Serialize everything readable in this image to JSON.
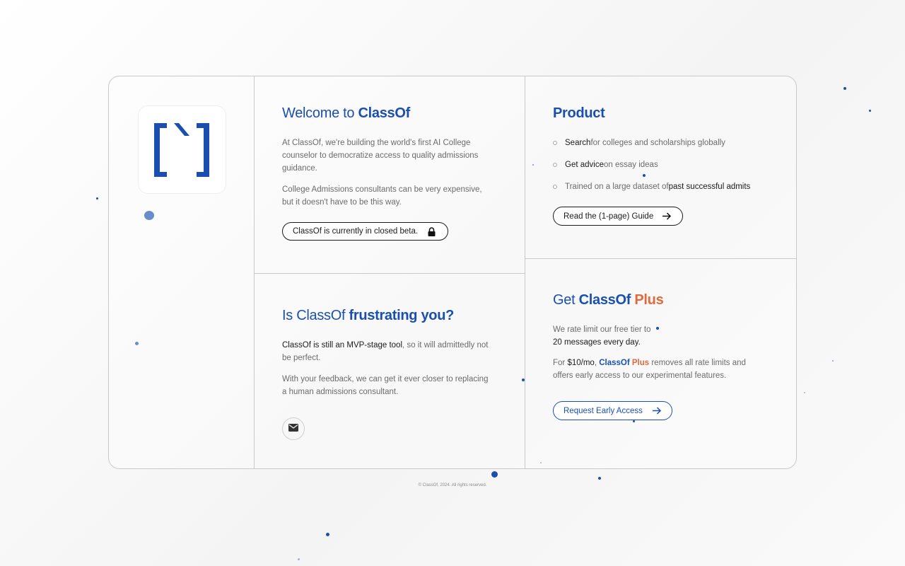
{
  "brand": {
    "name": "ClassOf",
    "accent": "#1a4fb0",
    "plus_color": "#e06a3b"
  },
  "welcome": {
    "title_prefix": "Welcome to ",
    "title_brand": "ClassOf",
    "para1": "At ClassOf, we're building the world's first AI College counselor to democratize access to quality admissions guidance.",
    "para2": "College Admissions consultants can be very expensive, but it doesn't have to be this way.",
    "beta_label": "ClassOf is currently in closed beta.",
    "beta_icon": "lock-icon"
  },
  "frustrated": {
    "title_prefix": "Is ClassOf ",
    "title_bold": "frustrating you?",
    "para1_dark": "ClassOf is still an MVP-stage tool",
    "para1_rest": ", so it will admittedly not be perfect.",
    "para2": "With your feedback, we can get it ever closer to replacing a human admissions consultant.",
    "mail_icon": "envelope-icon"
  },
  "product": {
    "title": "Product",
    "items": [
      {
        "bold": "Search",
        "rest": " for colleges and scholarships globally",
        "bold_first": true
      },
      {
        "bold": "Get advice",
        "rest": " on essay ideas",
        "bold_first": true
      },
      {
        "bold": "past successful admits",
        "rest": "Trained on a large dataset of ",
        "bold_first": false
      }
    ],
    "guide_label": "Read the (1-page) Guide",
    "guide_icon": "arrow-right-icon"
  },
  "plus": {
    "title_prefix": "Get ",
    "title_brand": "ClassOf",
    "title_plus": " Plus",
    "para1_rest": "We rate limit our free tier to",
    "para1_dark": "20 messages every day.",
    "para2_for": "For ",
    "para2_price": "$10/mo",
    "para2_comma": ", ",
    "para2_brand": "ClassOf",
    "para2_plus": " Plus",
    "para2_rest": " removes all rate limits and offers early access to our experimental features.",
    "cta_label": "Request Early Access",
    "cta_icon": "arrow-right-icon"
  },
  "footer": {
    "text": "© ClassOf, 2024. All rights reserved."
  }
}
